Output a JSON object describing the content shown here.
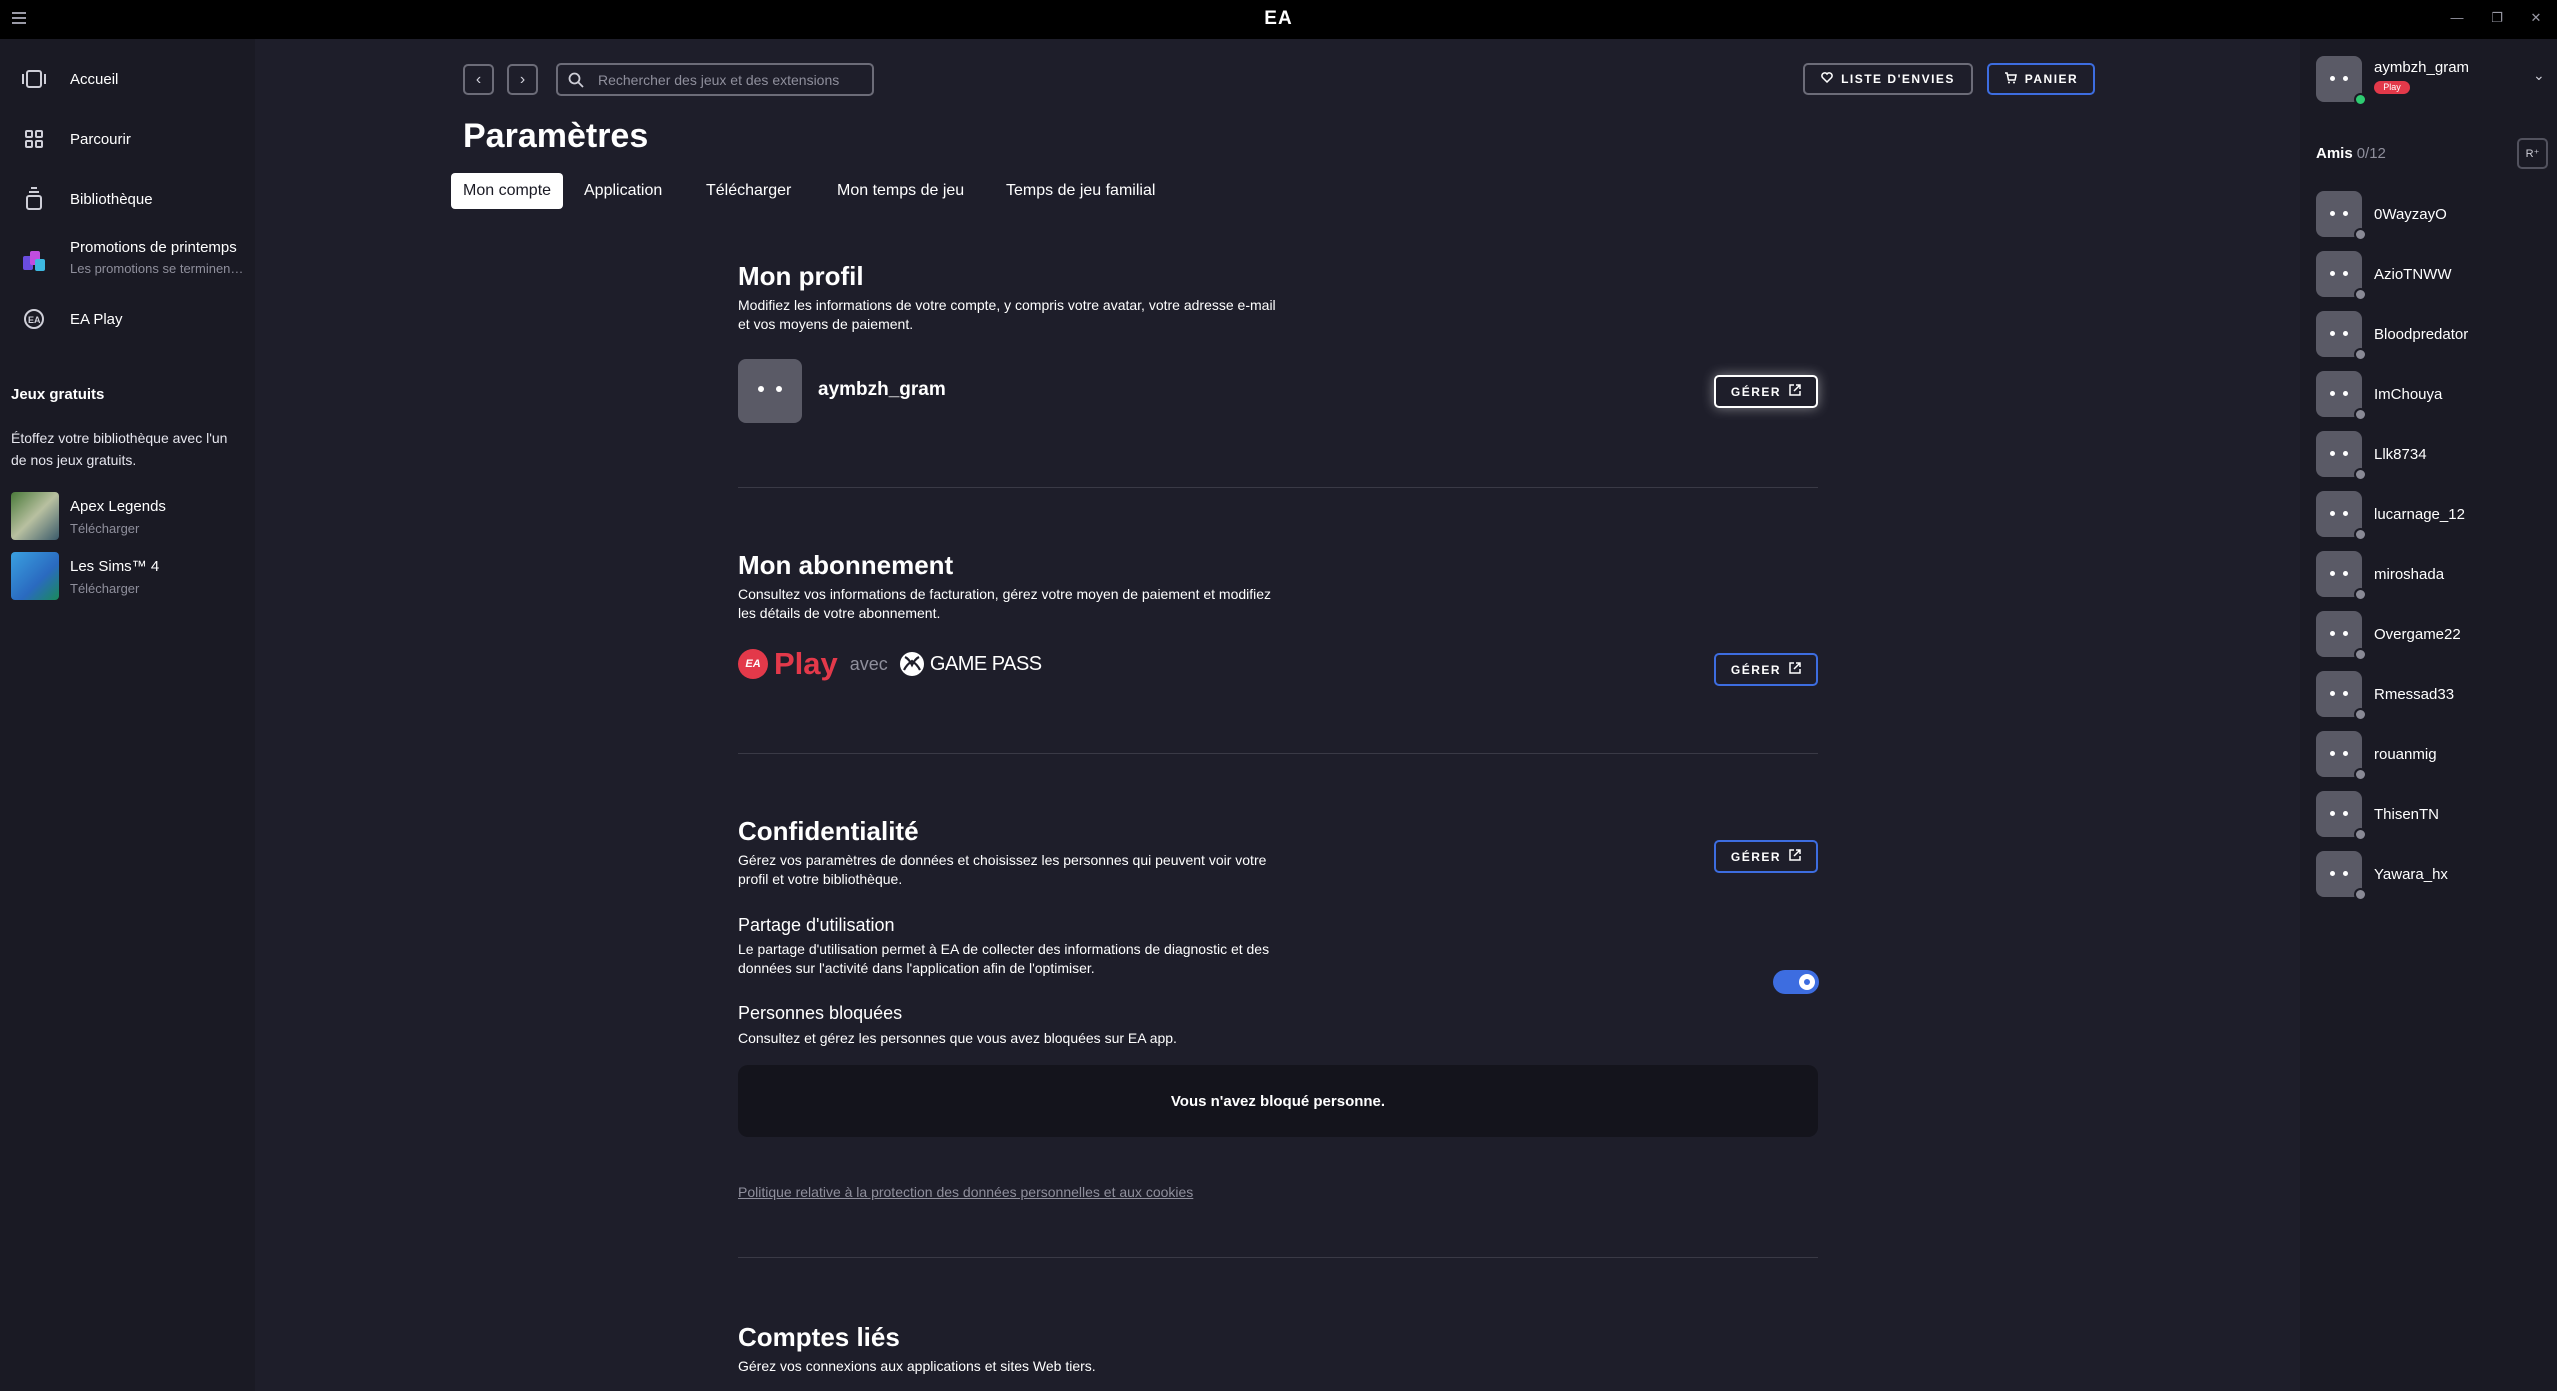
{
  "titlebar": {
    "title": "EA",
    "minimize": "—",
    "maximize": "❐",
    "close": "✕"
  },
  "sidebar": {
    "nav": [
      {
        "label": "Accueil",
        "icon": "home-icon"
      },
      {
        "label": "Parcourir",
        "icon": "grid-icon"
      },
      {
        "label": "Bibliothèque",
        "icon": "library-icon"
      },
      {
        "label": "Promotions de printemps",
        "sub": "Les promotions se terminen…",
        "icon": "promo-icon"
      },
      {
        "label": "EA Play",
        "icon": "ea-play-icon"
      }
    ],
    "free_games": {
      "title": "Jeux gratuits",
      "text": "Étoffez votre bibliothèque avec l'un de nos jeux gratuits.",
      "games": [
        {
          "name": "Apex Legends",
          "action": "Télécharger"
        },
        {
          "name": "Les Sims™ 4",
          "action": "Télécharger"
        }
      ]
    }
  },
  "header": {
    "search_placeholder": "Rechercher des jeux et des extensions",
    "wishlist": "LISTE D'ENVIES",
    "cart": "PANIER"
  },
  "page": {
    "title": "Paramètres",
    "tabs": [
      "Mon compte",
      "Application",
      "Télécharger",
      "Mon temps de jeu",
      "Temps de jeu familial"
    ],
    "active_tab": "Mon compte"
  },
  "profile": {
    "title": "Mon profil",
    "desc1": "Modifiez les informations de votre compte, y compris votre avatar, votre adresse e-mail",
    "desc2": "et vos moyens de paiement.",
    "username": "aymbzh_gram",
    "manage": "GÉRER"
  },
  "subscription": {
    "title": "Mon abonnement",
    "desc1": "Consultez vos informations de facturation, gérez votre moyen de paiement et modifiez",
    "desc2": "les détails de votre abonnement.",
    "logo_ea": "EA",
    "logo_play": "Play",
    "logo_avec": "avec",
    "logo_gamepass": "GAME PASS",
    "manage": "GÉRER"
  },
  "privacy": {
    "title": "Confidentialité",
    "desc1": "Gérez vos paramètres de données et choisissez les personnes qui peuvent voir votre",
    "desc2": "profil et votre bibliothèque.",
    "manage": "GÉRER",
    "usage_title": "Partage d'utilisation",
    "usage_desc1": "Le partage d'utilisation permet à EA de collecter des informations de diagnostic et des",
    "usage_desc2": "données sur l'activité dans l'application afin de l'optimiser.",
    "usage_enabled": true,
    "blocked_title": "Personnes bloquées",
    "blocked_desc": "Consultez et gérez les personnes que vous avez bloquées sur EA app.",
    "blocked_empty": "Vous n'avez bloqué personne.",
    "policy_link": "Politique relative à la protection des données personnelles et aux cookies"
  },
  "linked": {
    "title": "Comptes liés",
    "desc": "Gérez vos connexions aux applications et sites Web tiers."
  },
  "friends_panel": {
    "me": {
      "name": "aymbzh_gram",
      "badge": "Play",
      "status": "online"
    },
    "title": "Amis",
    "count": "0/12",
    "add_icon": "R⁺",
    "friends": [
      "0WayzayO",
      "AzioTNWW",
      "Bloodpredator",
      "ImChouya",
      "Llk8734",
      "lucarnage_12",
      "miroshada",
      "Overgame22",
      "Rmessad33",
      "rouanmig",
      "ThisenTN",
      "Yawara_hx"
    ]
  },
  "colors": {
    "background": "#1e1e2a",
    "sidebar": "#1a1a24",
    "accent_blue": "#3d6de0",
    "ea_red": "#e3394a",
    "online_green": "#2ecc71",
    "offline_gray": "#8a8a96"
  }
}
